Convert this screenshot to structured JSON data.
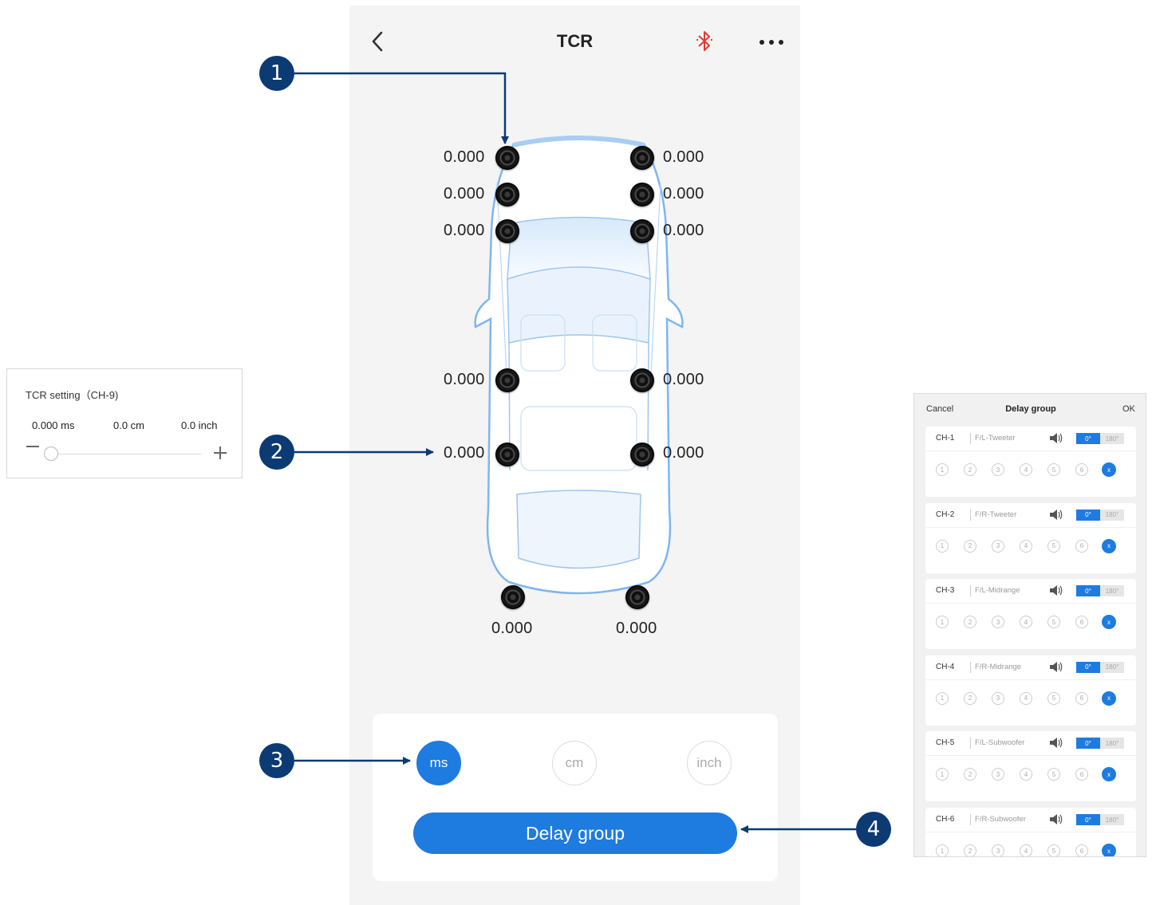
{
  "app": {
    "title": "TCR",
    "icons": {
      "back": "chevron-left-icon",
      "bluetooth": "bluetooth-icon",
      "more": "more-dots-icon"
    },
    "colors": {
      "accent": "#1e7be0",
      "bluetooth": "#e53935",
      "callout": "#0c3a73"
    }
  },
  "speakers": {
    "front_left": [
      "0.000",
      "0.000",
      "0.000"
    ],
    "front_right": [
      "0.000",
      "0.000",
      "0.000"
    ],
    "mid_left": "0.000",
    "mid_right": "0.000",
    "rear_left": "0.000",
    "rear_right": "0.000",
    "sub_left": "0.000",
    "sub_right": "0.000"
  },
  "units": {
    "options": [
      "ms",
      "cm",
      "inch"
    ],
    "selected": "ms"
  },
  "delay_group_button": "Delay group",
  "callouts": [
    "1",
    "2",
    "3",
    "4"
  ],
  "tcr_setting": {
    "title": "TCR setting（CH-9)",
    "ms": "0.000 ms",
    "cm": "0.0 cm",
    "inch": "0.0 inch",
    "slider_value": 0
  },
  "delay_group": {
    "cancel": "Cancel",
    "title": "Delay group",
    "ok": "OK",
    "phase_options": [
      "0°",
      "180°"
    ],
    "group_numbers": [
      "1",
      "2",
      "3",
      "4",
      "5",
      "6"
    ],
    "clear_label": "x",
    "channels": [
      {
        "ch": "CH-1",
        "name": "F/L-Tweeter",
        "phase": "0°"
      },
      {
        "ch": "CH-2",
        "name": "F/R-Tweeter",
        "phase": "0°"
      },
      {
        "ch": "CH-3",
        "name": "F/L-Midrange",
        "phase": "0°"
      },
      {
        "ch": "CH-4",
        "name": "F/R-Midrange",
        "phase": "0°"
      },
      {
        "ch": "CH-5",
        "name": "F/L-Subwoofer",
        "phase": "0°"
      },
      {
        "ch": "CH-6",
        "name": "F/R-Subwoofer",
        "phase": "0°"
      }
    ]
  }
}
